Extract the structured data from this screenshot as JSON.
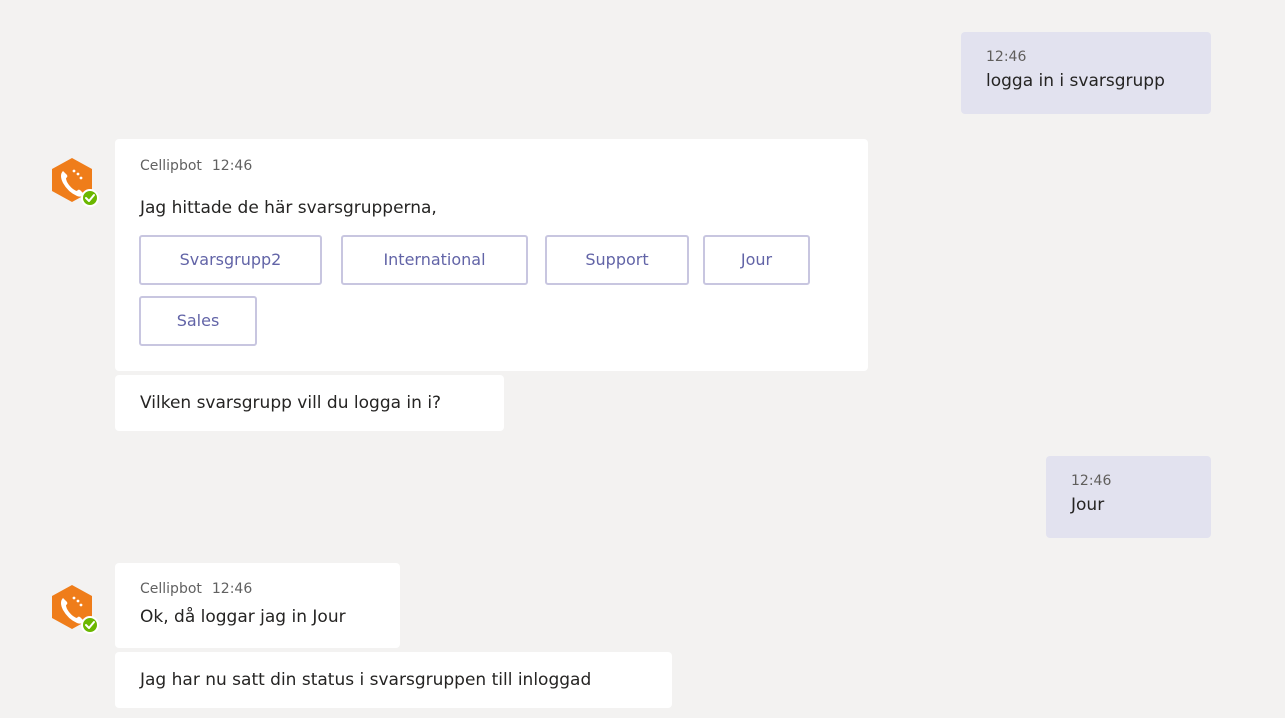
{
  "colors": {
    "background": "#f3f2f1",
    "my_bubble": "#e2e2ef",
    "bot_card": "#ffffff",
    "button_text": "#6264a7",
    "button_border": "#c8c6e0",
    "avatar_orange": "#ef7d1a",
    "status_green": "#6bb700"
  },
  "messages": {
    "me1": {
      "time": "12:46",
      "text": "logga in i svarsgrupp"
    },
    "bot1": {
      "sender": "Cellipbot",
      "time": "12:46",
      "text": "Jag hittade de här svarsgrupperna,",
      "buttons": [
        "Svarsgrupp2",
        "International",
        "Support",
        "Jour",
        "Sales"
      ],
      "followup": "Vilken svarsgrupp vill du logga in i?"
    },
    "me2": {
      "time": "12:46",
      "text": "Jour"
    },
    "bot2": {
      "sender": "Cellipbot",
      "time": "12:46",
      "text": "Ok, då loggar jag in Jour",
      "followup": "Jag har nu satt din status i svarsgruppen till inloggad"
    }
  },
  "icons": {
    "avatar": "phone-hexagon-icon",
    "status": "check-circle-icon"
  }
}
